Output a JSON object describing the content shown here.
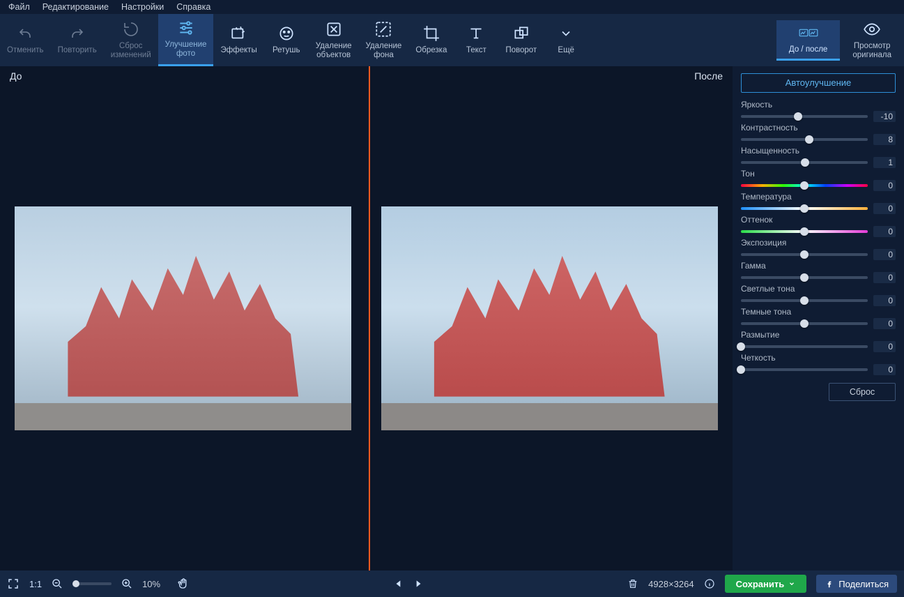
{
  "menu": {
    "file": "Файл",
    "edit": "Редактирование",
    "settings": "Настройки",
    "help": "Справка"
  },
  "tools": {
    "undo": "Отменить",
    "redo": "Повторить",
    "reset_changes": "Сброс\nизменений",
    "enhance": "Улучшение\nфото",
    "effects": "Эффекты",
    "retouch": "Ретушь",
    "remove_objects": "Удаление\nобъектов",
    "remove_bg": "Удаление\nфона",
    "crop": "Обрезка",
    "text": "Текст",
    "rotate": "Поворот",
    "more": "Ещё",
    "before_after": "До / после",
    "view_original": "Просмотр\nоригинала"
  },
  "canvas": {
    "before_label": "До",
    "after_label": "После"
  },
  "panel": {
    "auto_enhance": "Автоулучшение",
    "reset": "Сброс",
    "sliders": [
      {
        "label": "Яркость",
        "value": -10,
        "pos": 0.45,
        "style": "plain"
      },
      {
        "label": "Контрастность",
        "value": 8,
        "pos": 0.54,
        "style": "plain"
      },
      {
        "label": "Насыщенность",
        "value": 1,
        "pos": 0.505,
        "style": "plain"
      },
      {
        "label": "Тон",
        "value": 0,
        "pos": 0.5,
        "style": "hue"
      },
      {
        "label": "Температура",
        "value": 0,
        "pos": 0.5,
        "style": "temp"
      },
      {
        "label": "Оттенок",
        "value": 0,
        "pos": 0.5,
        "style": "tint"
      },
      {
        "label": "Экспозиция",
        "value": 0,
        "pos": 0.5,
        "style": "plain"
      },
      {
        "label": "Гамма",
        "value": 0,
        "pos": 0.5,
        "style": "plain"
      },
      {
        "label": "Светлые тона",
        "value": 0,
        "pos": 0.5,
        "style": "plain"
      },
      {
        "label": "Темные тона",
        "value": 0,
        "pos": 0.5,
        "style": "plain"
      },
      {
        "label": "Размытие",
        "value": 0,
        "pos": 0.0,
        "style": "plain"
      },
      {
        "label": "Четкость",
        "value": 0,
        "pos": 0.0,
        "style": "plain"
      }
    ]
  },
  "bottom": {
    "fit_label": "1:1",
    "zoom_percent": "10%",
    "dimensions": "4928×3264",
    "save": "Сохранить",
    "share": "Поделиться"
  }
}
